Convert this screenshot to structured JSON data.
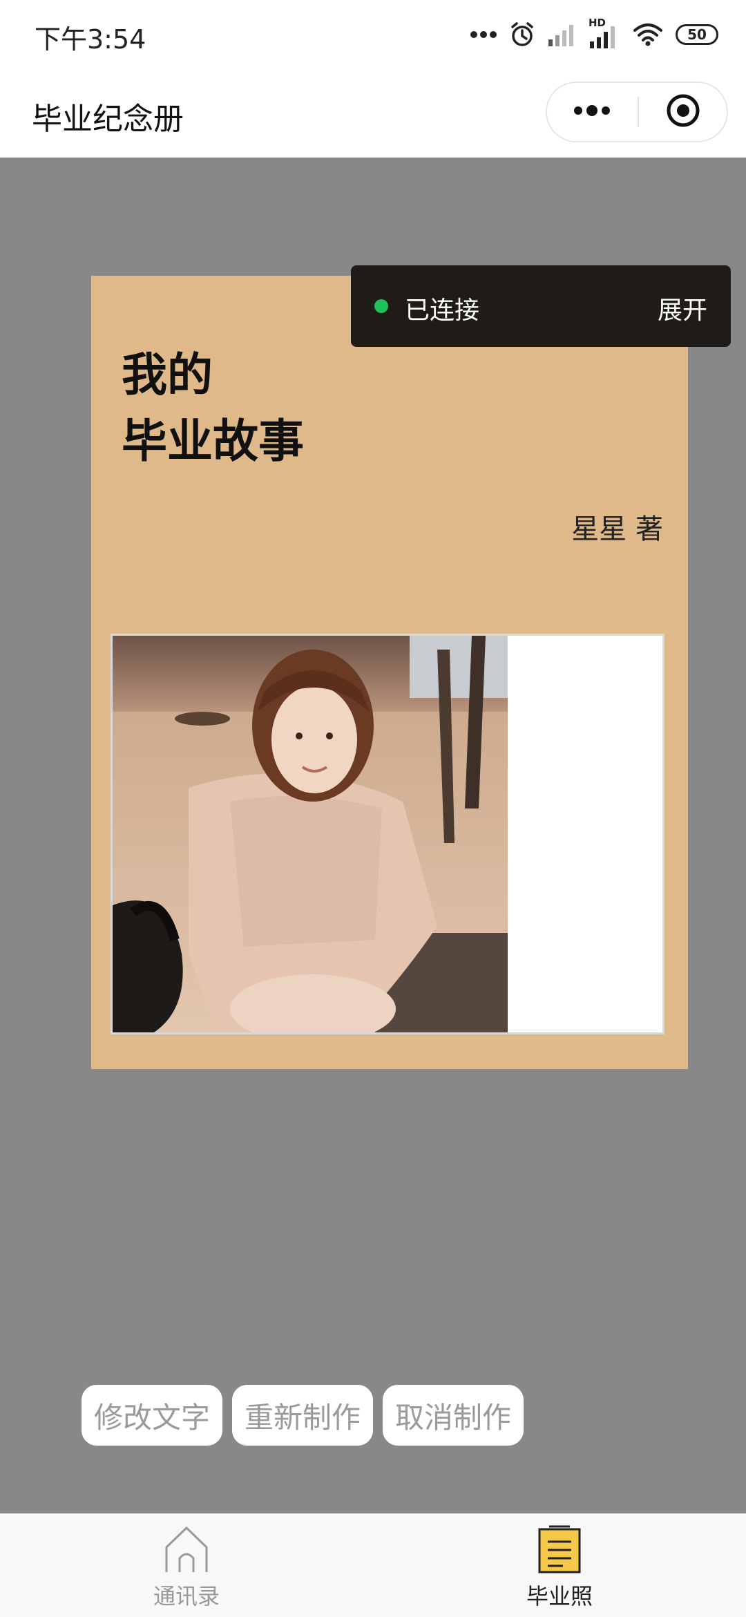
{
  "status_bar": {
    "time": "下午3:54",
    "hd_label": "HD",
    "battery": "50"
  },
  "title_bar": {
    "title": "毕业纪念册"
  },
  "toast": {
    "status": "已连接",
    "expand_label": "展开",
    "dot_color": "#1fc15b"
  },
  "cover": {
    "title_line1": "我的",
    "title_line2": "毕业故事",
    "author": "星星 著",
    "background_color": "#dfb98a"
  },
  "actions": {
    "edit_text": "修改文字",
    "remake": "重新制作",
    "cancel": "取消制作"
  },
  "tab_bar": {
    "items": [
      {
        "label": "通讯录",
        "icon": "home-icon",
        "active": false
      },
      {
        "label": "毕业照",
        "icon": "notepad-icon",
        "active": true
      }
    ]
  }
}
